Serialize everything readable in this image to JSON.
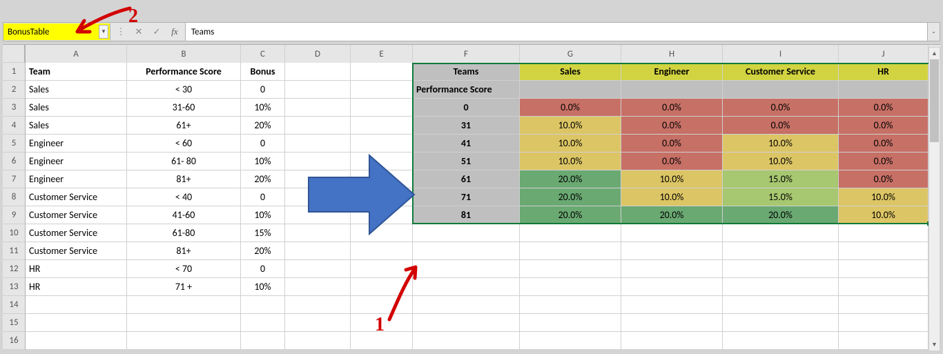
{
  "nameBox": "BonusTable",
  "formula": "Teams",
  "colHeaders": [
    "A",
    "B",
    "C",
    "D",
    "E",
    "F",
    "G",
    "H",
    "I",
    "J"
  ],
  "rowCount": 16,
  "leftTable": {
    "headers": {
      "team": "Team",
      "perf": "Performance Score",
      "bonus": "Bonus"
    },
    "rows": [
      {
        "team": "Sales",
        "perf": "< 30",
        "bonus": "0"
      },
      {
        "team": "Sales",
        "perf": "31-60",
        "bonus": "10%"
      },
      {
        "team": "Sales",
        "perf": "61+",
        "bonus": "20%"
      },
      {
        "team": "Engineer",
        "perf": "< 60",
        "bonus": "0"
      },
      {
        "team": "Engineer",
        "perf": "61- 80",
        "bonus": "10%"
      },
      {
        "team": "Engineer",
        "perf": "81+",
        "bonus": "20%"
      },
      {
        "team": "Customer Service",
        "perf": "< 40",
        "bonus": "0"
      },
      {
        "team": "Customer Service",
        "perf": "41-60",
        "bonus": "10%"
      },
      {
        "team": "Customer Service",
        "perf": "61-80",
        "bonus": "15%"
      },
      {
        "team": "Customer Service",
        "perf": "81+",
        "bonus": "20%"
      },
      {
        "team": "HR",
        "perf": "< 70",
        "bonus": "0"
      },
      {
        "team": "HR",
        "perf": "71 +",
        "bonus": "10%"
      }
    ]
  },
  "bonusTable": {
    "teamsLabel": "Teams",
    "perfLabel": "Performance Score",
    "teams": [
      "Sales",
      "Engineer",
      "Customer Service",
      "HR"
    ],
    "scores": [
      "0",
      "31",
      "41",
      "51",
      "61",
      "71",
      "81"
    ],
    "matrix": [
      [
        {
          "v": "0.0%",
          "c": "r"
        },
        {
          "v": "0.0%",
          "c": "r"
        },
        {
          "v": "0.0%",
          "c": "r"
        },
        {
          "v": "0.0%",
          "c": "r"
        }
      ],
      [
        {
          "v": "10.0%",
          "c": "y"
        },
        {
          "v": "0.0%",
          "c": "r"
        },
        {
          "v": "0.0%",
          "c": "r"
        },
        {
          "v": "0.0%",
          "c": "r"
        }
      ],
      [
        {
          "v": "10.0%",
          "c": "y"
        },
        {
          "v": "0.0%",
          "c": "r"
        },
        {
          "v": "10.0%",
          "c": "y"
        },
        {
          "v": "0.0%",
          "c": "r"
        }
      ],
      [
        {
          "v": "10.0%",
          "c": "y"
        },
        {
          "v": "0.0%",
          "c": "r"
        },
        {
          "v": "10.0%",
          "c": "y"
        },
        {
          "v": "0.0%",
          "c": "r"
        }
      ],
      [
        {
          "v": "20.0%",
          "c": "g"
        },
        {
          "v": "10.0%",
          "c": "y"
        },
        {
          "v": "15.0%",
          "c": "g3"
        },
        {
          "v": "0.0%",
          "c": "r"
        }
      ],
      [
        {
          "v": "20.0%",
          "c": "g"
        },
        {
          "v": "10.0%",
          "c": "y"
        },
        {
          "v": "15.0%",
          "c": "g3"
        },
        {
          "v": "10.0%",
          "c": "y"
        }
      ],
      [
        {
          "v": "20.0%",
          "c": "g"
        },
        {
          "v": "20.0%",
          "c": "g"
        },
        {
          "v": "20.0%",
          "c": "g"
        },
        {
          "v": "10.0%",
          "c": "y"
        }
      ]
    ]
  },
  "annotations": {
    "one": "1",
    "two": "2"
  },
  "chart_data": {
    "type": "table",
    "title": "BonusTable",
    "columns": [
      "Performance Score",
      "Sales",
      "Engineer",
      "Customer Service",
      "HR"
    ],
    "rows": [
      [
        0,
        0.0,
        0.0,
        0.0,
        0.0
      ],
      [
        31,
        10.0,
        0.0,
        0.0,
        0.0
      ],
      [
        41,
        10.0,
        0.0,
        10.0,
        0.0
      ],
      [
        51,
        10.0,
        0.0,
        10.0,
        0.0
      ],
      [
        61,
        20.0,
        10.0,
        15.0,
        0.0
      ],
      [
        71,
        20.0,
        10.0,
        15.0,
        10.0
      ],
      [
        81,
        20.0,
        20.0,
        20.0,
        10.0
      ]
    ],
    "units": "percent"
  }
}
